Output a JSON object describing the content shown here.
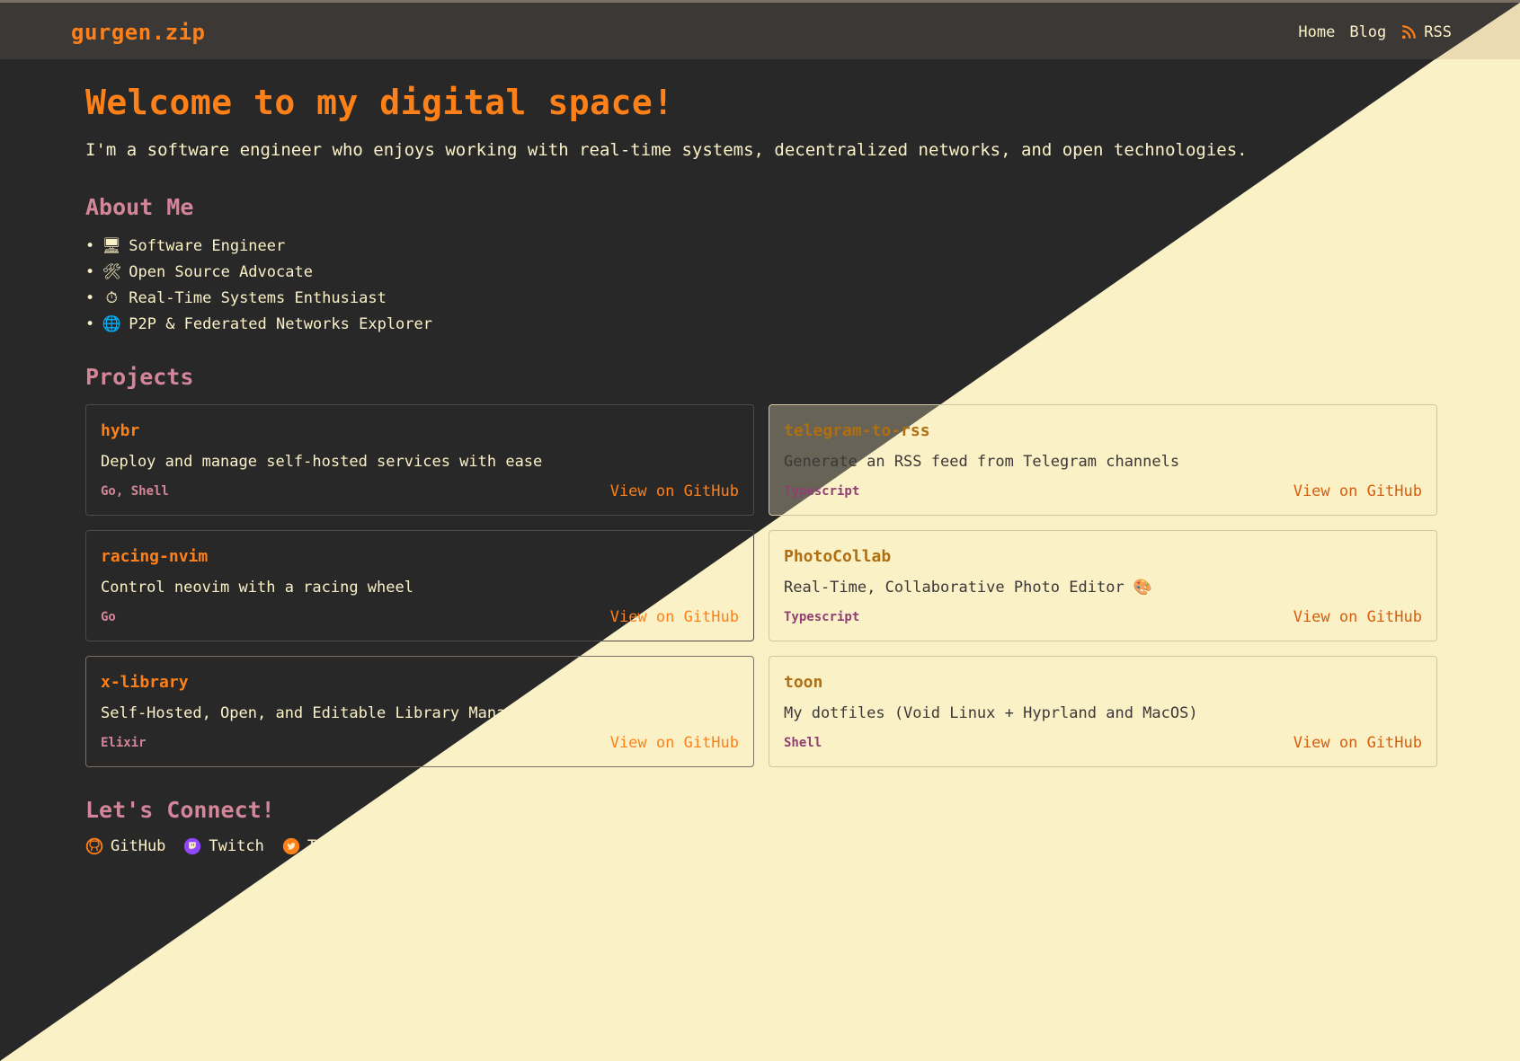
{
  "site": {
    "logo": "gurgen.zip"
  },
  "nav": [
    {
      "label": "Home",
      "icon": null
    },
    {
      "label": "Blog",
      "icon": null
    },
    {
      "label": "RSS",
      "icon": "rss-icon"
    }
  ],
  "hero": {
    "title": "Welcome to my digital space!",
    "intro": "I'm a software engineer who enjoys working with real-time systems, decentralized networks, and open technologies."
  },
  "about": {
    "title": "About Me",
    "items": [
      {
        "emoji": "🖥",
        "icon": "computer-icon",
        "label": "Software Engineer"
      },
      {
        "emoji": "🛠",
        "icon": "tools-icon",
        "label": "Open Source Advocate"
      },
      {
        "emoji": "⏱",
        "icon": "stopwatch-icon",
        "label": "Real-Time Systems Enthusiast"
      },
      {
        "emoji": "🌐",
        "icon": "globe-icon",
        "label": "P2P & Federated Networks Explorer"
      }
    ]
  },
  "projects": {
    "title": "Projects",
    "items": [
      {
        "name": "hybr",
        "desc": "Deploy and manage self-hosted services with ease",
        "lang": "Go, Shell",
        "link": "View on GitHub"
      },
      {
        "name": "telegram-to-rss",
        "desc": "Generate an RSS feed from Telegram channels",
        "lang": "Typescript",
        "link": "View on GitHub"
      },
      {
        "name": "racing-nvim",
        "desc": "Control neovim with a racing wheel",
        "lang": "Go",
        "link": "View on GitHub"
      },
      {
        "name": "PhotoCollab",
        "desc": "Real-Time, Collaborative Photo Editor 🎨",
        "lang": "Typescript",
        "link": "View on GitHub"
      },
      {
        "name": "x-library",
        "desc": "Self-Hosted, Open, and Editable Library Management Platform",
        "lang": "Elixir",
        "link": "View on GitHub"
      },
      {
        "name": "toon",
        "desc": "My dotfiles (Void Linux + Hyprland and MacOS)",
        "lang": "Shell",
        "link": "View on GitHub"
      }
    ]
  },
  "connect": {
    "title": "Let's Connect!",
    "links": [
      {
        "label": "GitHub",
        "icon": "github-icon"
      },
      {
        "label": "Twitch",
        "icon": "twitch-icon"
      },
      {
        "label": "Twitter",
        "icon": "twitter-icon"
      }
    ]
  },
  "colors": {
    "dark_bg": "#282828",
    "light_bg": "#fbf1c7",
    "accent": "#fe8019",
    "heading": "#d3869b",
    "text": "#fbf1c7"
  }
}
